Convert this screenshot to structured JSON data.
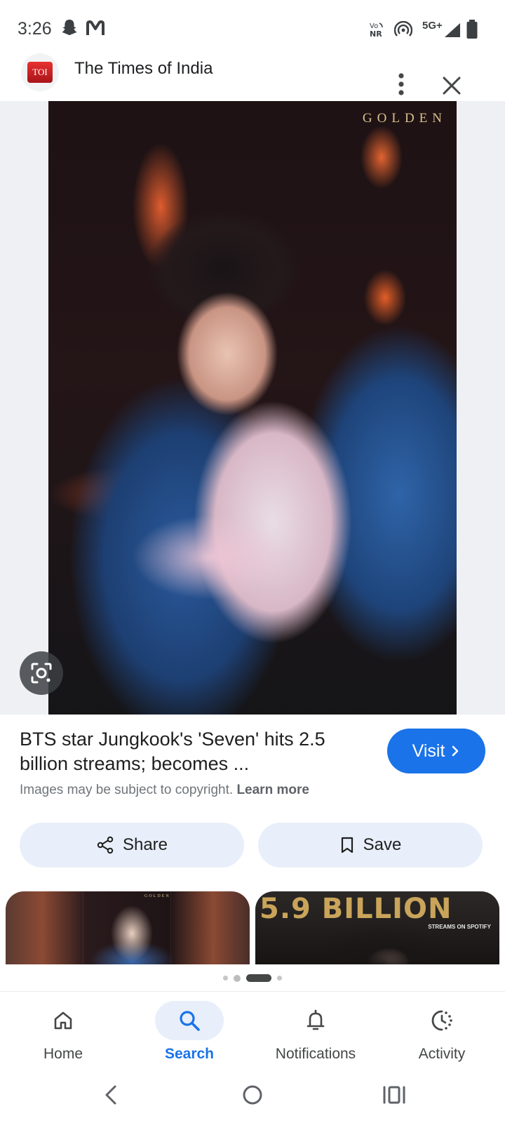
{
  "status_bar": {
    "time": "3:26",
    "volte_label_top": "Vo",
    "volte_label_bottom": "NR",
    "network_label": "5G+",
    "icons": [
      "snapchat-ghost-icon",
      "gmail-m-icon",
      "volte-icon",
      "hotspot-icon",
      "signal-icon",
      "battery-icon"
    ]
  },
  "header": {
    "favicon_text": "TOI",
    "site_name": "The Times of India"
  },
  "image": {
    "brand_text": "GOLDEN"
  },
  "result": {
    "title": "BTS star Jungkook's 'Seven' hits 2.5 billion streams; becomes ...",
    "visit_label": "Visit",
    "copyright_text": "Images may be subject to copyright.",
    "learn_more": "Learn more"
  },
  "actions": {
    "share_label": "Share",
    "save_label": "Save"
  },
  "related": {
    "thumb1_brand": "GOLDEN",
    "thumb2_title": "5.9 BILLION",
    "thumb2_subtitle": "STREAMS ON SPOTIFY"
  },
  "bottom_nav": {
    "items": [
      {
        "label": "Home",
        "icon": "home-icon"
      },
      {
        "label": "Search",
        "icon": "search-icon"
      },
      {
        "label": "Notifications",
        "icon": "bell-icon"
      },
      {
        "label": "Activity",
        "icon": "activity-icon"
      }
    ],
    "active": "Search"
  },
  "colors": {
    "accent": "#1a73e8",
    "pill_bg": "#e8effa"
  }
}
